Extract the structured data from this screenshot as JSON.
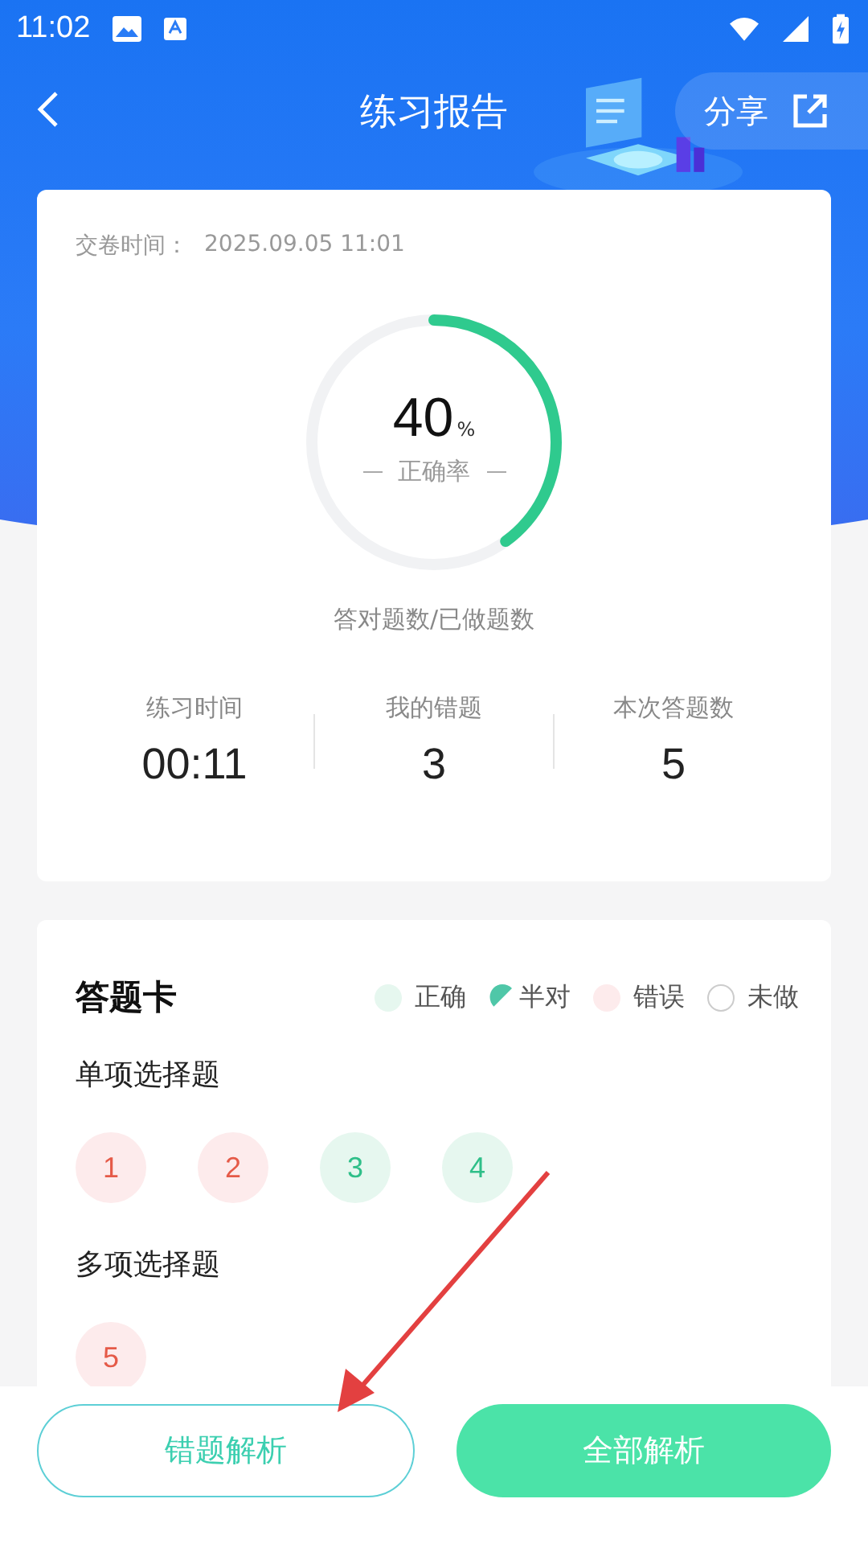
{
  "status_bar": {
    "time": "11:02"
  },
  "nav": {
    "title": "练习报告",
    "share": "分享"
  },
  "summary": {
    "submit_label": "交卷时间：",
    "submit_time": "2025.09.05 11:01",
    "rate": "40",
    "rate_unit": "%",
    "rate_label": "正确率",
    "level": 0.4,
    "caption": "答对题数/已做题数",
    "stats": [
      {
        "label": "练习时间",
        "value": "00:11"
      },
      {
        "label": "我的错题",
        "value": "3"
      },
      {
        "label": "本次答题数",
        "value": "5"
      }
    ]
  },
  "answer_card": {
    "title": "答题卡",
    "legend": [
      {
        "kind": "correct",
        "label": "正确"
      },
      {
        "kind": "half",
        "label": "半对"
      },
      {
        "kind": "wrong",
        "label": "错误"
      },
      {
        "kind": "undone",
        "label": "未做"
      }
    ],
    "sections": [
      {
        "title": "单项选择题",
        "questions": [
          {
            "number": "1",
            "kind": "wrong"
          },
          {
            "number": "2",
            "kind": "wrong"
          },
          {
            "number": "3",
            "kind": "correct"
          },
          {
            "number": "4",
            "kind": "correct"
          }
        ]
      },
      {
        "title": "多项选择题",
        "questions": [
          {
            "number": "5",
            "kind": "wrong"
          }
        ]
      }
    ]
  },
  "buttons": [
    {
      "label": "错题解析",
      "kind": "outline"
    },
    {
      "label": "全部解析",
      "kind": "filled"
    }
  ]
}
